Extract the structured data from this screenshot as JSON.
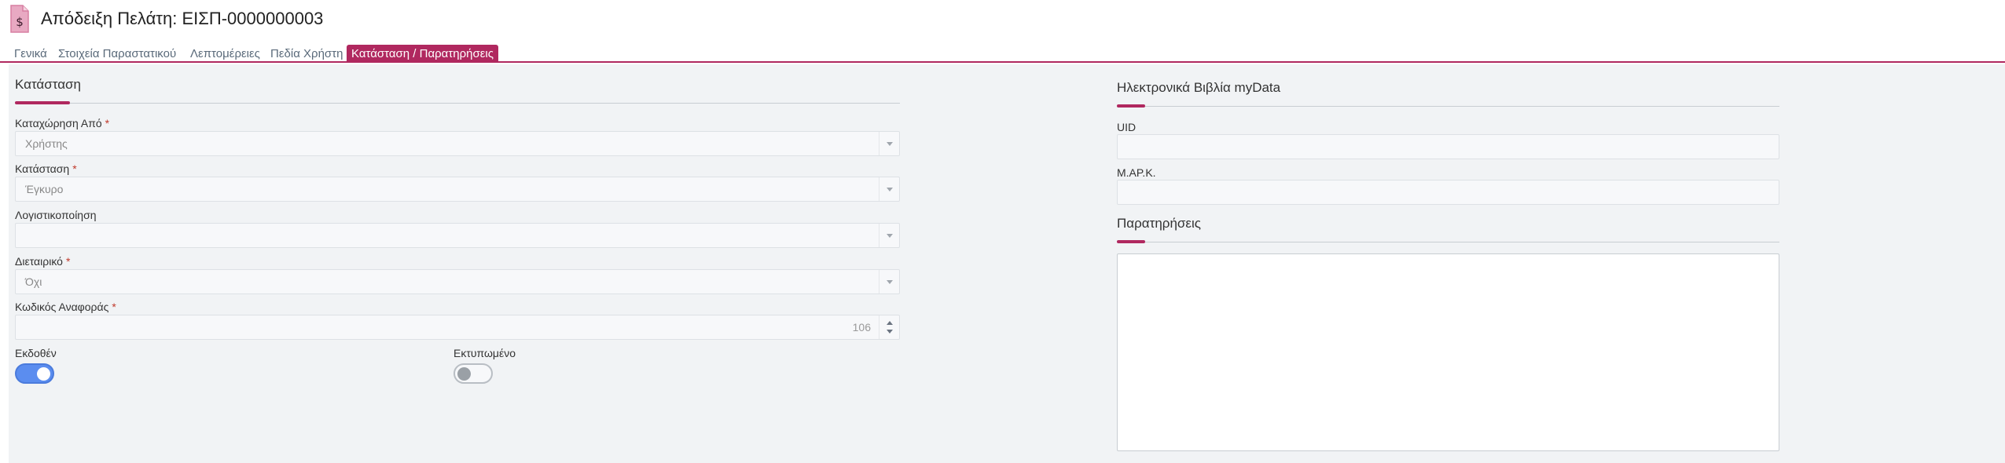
{
  "header": {
    "title": "Απόδειξη Πελάτη: ΕΙΣΠ-0000000003",
    "icon": "receipt-dollar-icon",
    "icon_color": "#d77fa1"
  },
  "tabs": [
    {
      "label": "Γενικά"
    },
    {
      "label": "Στοιχεία Παραστατικού"
    },
    {
      "label": "Λεπτομέρειες"
    },
    {
      "label": "Πεδία Χρήστη"
    },
    {
      "label": "Κατάσταση / Παρατηρήσεις",
      "active": true
    }
  ],
  "colors": {
    "accent": "#b0285f",
    "toggle_on": "#5b8def",
    "panel_bg": "#f1f3f5"
  },
  "status_section": {
    "title": "Κατάσταση",
    "fields": {
      "registered_by": {
        "label": "Καταχώρηση Από",
        "required": "*",
        "value": "Χρήστης"
      },
      "status": {
        "label": "Κατάσταση",
        "required": "*",
        "value": "Έγκυρο"
      },
      "accounting": {
        "label": "Λογιστικοποίηση",
        "value": ""
      },
      "clearing": {
        "label": "Διεταιρικό",
        "required": "*",
        "value": "Όχι"
      },
      "reference_code": {
        "label": "Κωδικός Αναφοράς",
        "required": "*",
        "value": "106"
      },
      "issued": {
        "label": "Εκδοθέν",
        "state": "on"
      },
      "printed": {
        "label": "Εκτυπωμένο",
        "state": "off"
      }
    }
  },
  "mydata_section": {
    "title": "Ηλεκτρονικά Βιβλία myData",
    "uid": {
      "label": "UID",
      "value": ""
    },
    "mark": {
      "label": "Μ.ΑΡ.Κ.",
      "value": ""
    }
  },
  "notes_section": {
    "title": "Παρατηρήσεις",
    "value": ""
  }
}
